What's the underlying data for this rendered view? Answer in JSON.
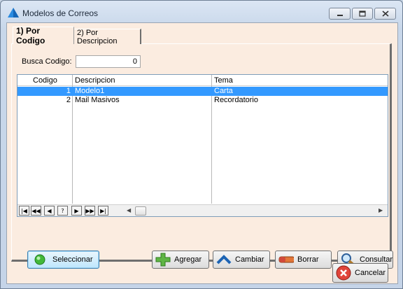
{
  "window": {
    "title": "Modelos de Correos"
  },
  "tabs": [
    {
      "label": "1) Por Codigo",
      "active": true
    },
    {
      "label": "2) Por Descripcion",
      "active": false
    }
  ],
  "search": {
    "label": "Busca Codigo:",
    "value": "0"
  },
  "grid": {
    "columns": [
      "Codigo",
      "Descripcion",
      "Tema"
    ],
    "rows": [
      {
        "codigo": "1",
        "descripcion": "Modelo1",
        "tema": "Carta",
        "selected": true
      },
      {
        "codigo": "2",
        "descripcion": "Mail Masivos",
        "tema": "Recordatorio",
        "selected": false
      }
    ],
    "selection_color": "#3399ff",
    "navigator": [
      "first",
      "prior-page",
      "prior",
      "help",
      "next",
      "next-page",
      "last"
    ],
    "navigator_glyphs": [
      "|◀",
      "◀◀",
      "◀",
      "?",
      "▶",
      "▶▶",
      "▶|"
    ]
  },
  "buttons": {
    "select": "Seleccionar",
    "add": "Agregar",
    "edit": "Cambiar",
    "delete": "Borrar",
    "query": "Consultar",
    "cancel": "Cancelar"
  },
  "icons": {
    "app": "pyramid-icon",
    "select": "green-dot-icon",
    "add": "plus-icon",
    "edit": "chevron-up-icon",
    "delete": "eraser-icon",
    "query": "magnifier-icon",
    "cancel": "cancel-circle-icon"
  }
}
